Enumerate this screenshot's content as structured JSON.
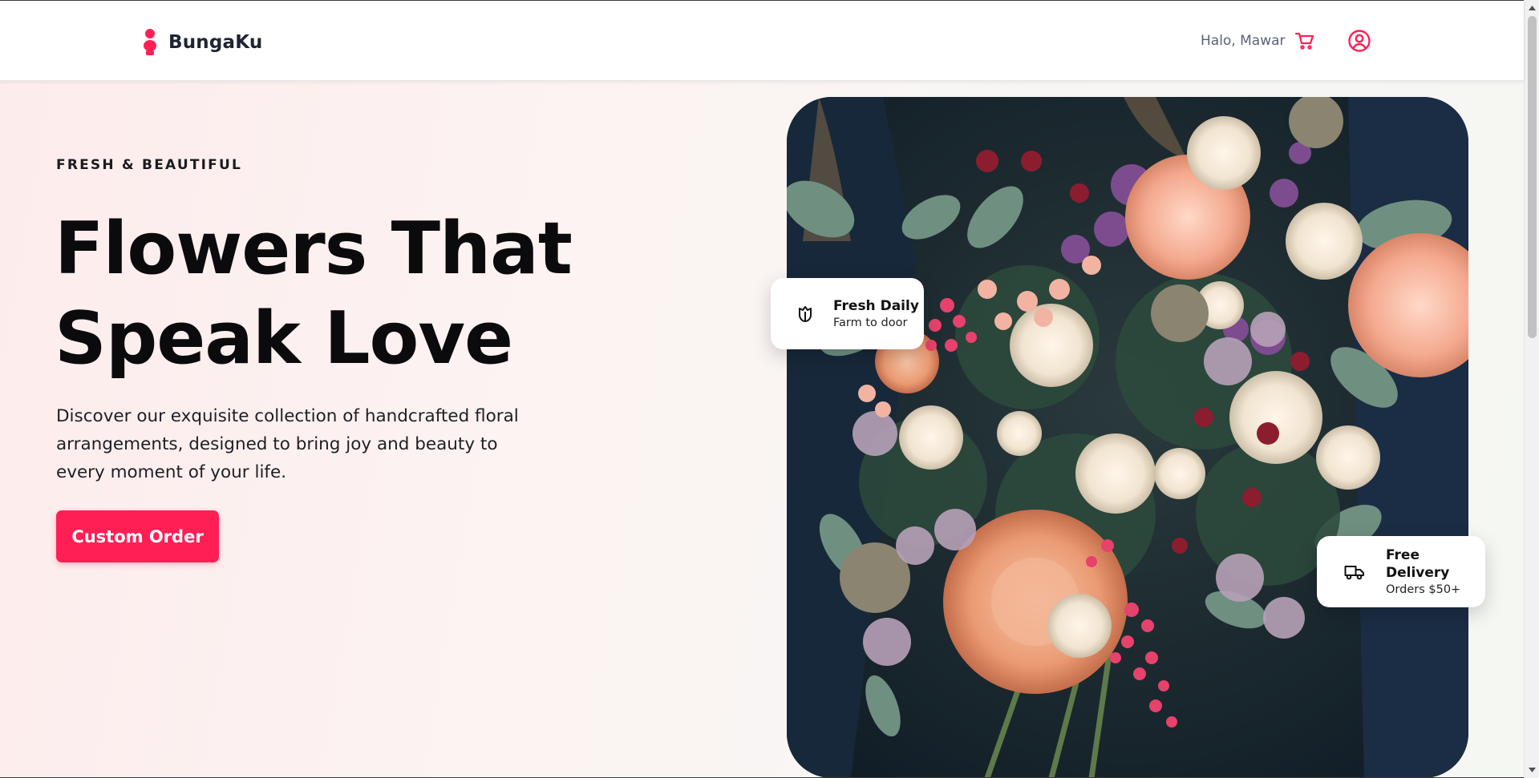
{
  "brand": {
    "name": "BungaKu",
    "accent": "#ff1f55",
    "logo_icon": "flower-pin-icon"
  },
  "header": {
    "greeting": "Halo, Mawar",
    "cart_icon": "shopping-cart-icon",
    "profile_icon": "user-circle-icon"
  },
  "hero": {
    "eyebrow": "FRESH & BEAUTIFUL",
    "headline_line1": "Flowers That",
    "headline_line2": "Speak Love",
    "description": "Discover our exquisite collection of handcrafted floral arrangements, designed to bring joy and beauty to every moment of your life.",
    "cta_label": "Custom Order",
    "image_subject": "flower-bouquet-photo"
  },
  "badges": {
    "fresh": {
      "icon": "tulip-icon",
      "title": "Fresh Daily",
      "subtitle": "Farm to door"
    },
    "delivery": {
      "icon": "truck-icon",
      "title": "Free Delivery",
      "subtitle": "Orders $50+"
    }
  },
  "colors": {
    "accent": "#ff1f55",
    "text_dark": "#0b0b0d",
    "muted": "#5b6275"
  }
}
